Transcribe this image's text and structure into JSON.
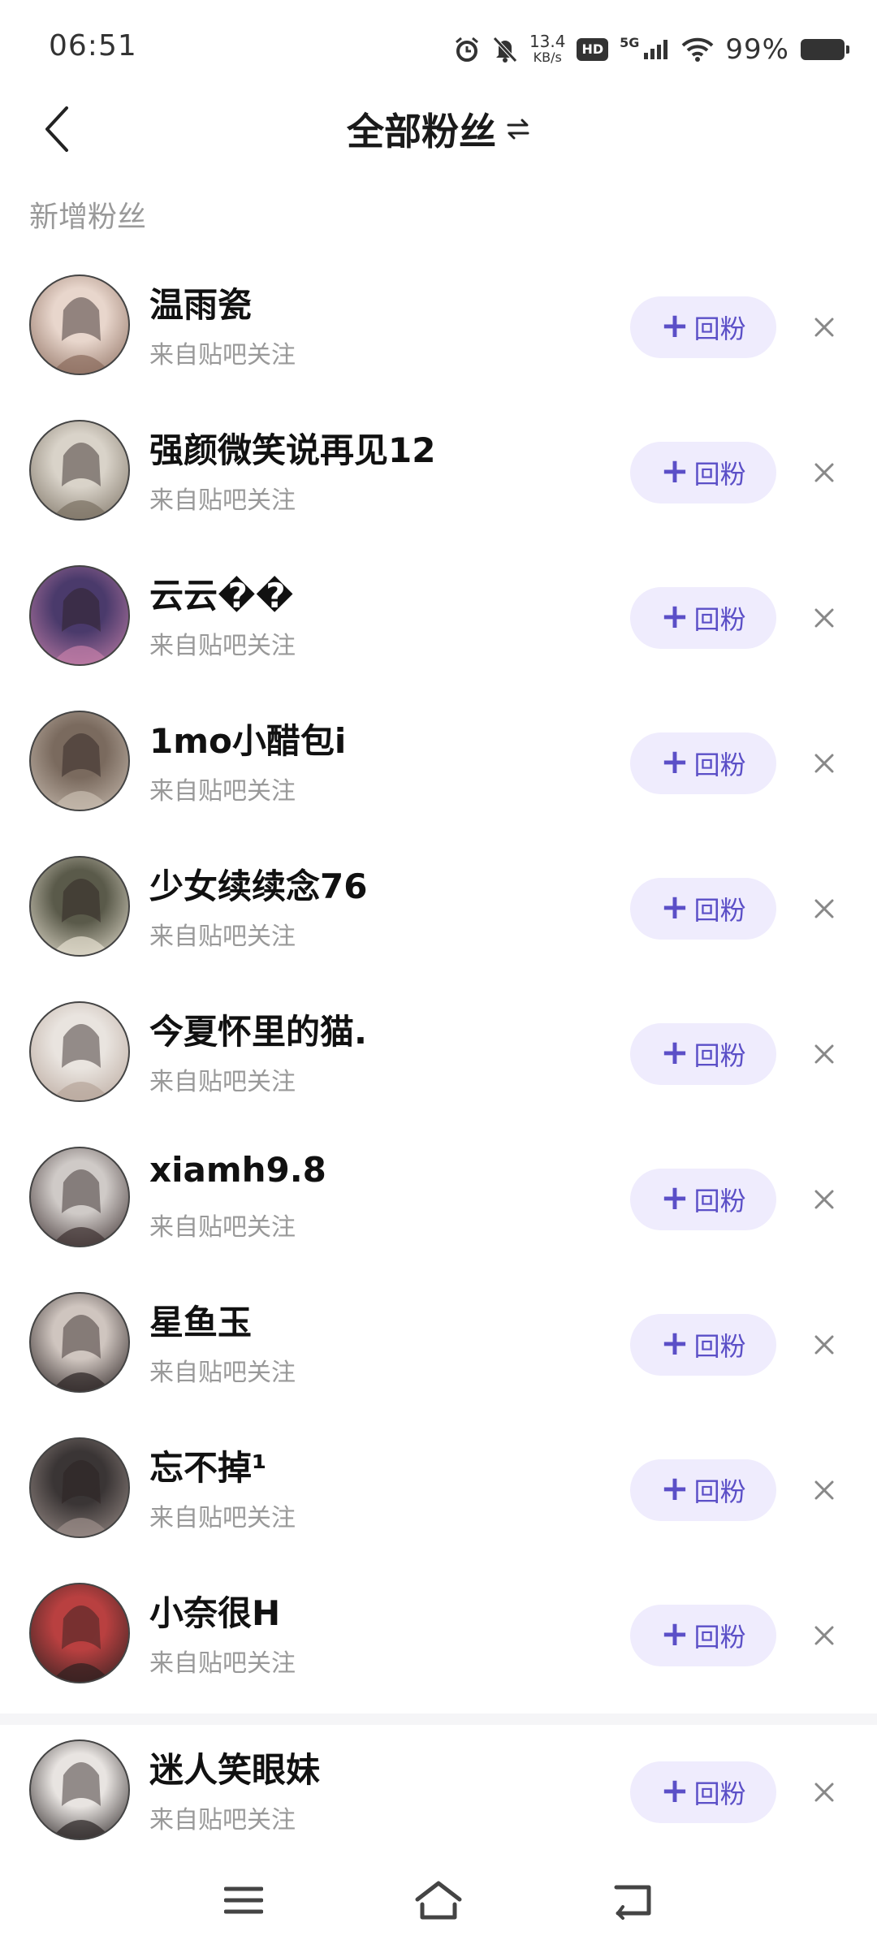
{
  "status_bar": {
    "time": "06:51",
    "net_speed_value": "13.4",
    "net_speed_unit": "KB/s",
    "hd_label": "HD",
    "signal_label": "5G",
    "battery_percent": "99%",
    "icons": [
      "alarm-icon",
      "mute-bell-icon",
      "hd-icon",
      "signal-5g-icon",
      "wifi-icon",
      "battery-icon"
    ]
  },
  "header": {
    "title": "全部粉丝",
    "back_icon": "chevron-left-icon",
    "switch_icon": "swap-arrows-icon"
  },
  "section": {
    "label": "新增粉丝"
  },
  "follow_button_label": "回粉",
  "follow_button_plus": "+",
  "colors": {
    "accent": "#5b4fc7",
    "button_bg": "#efecfd",
    "secondary_text": "#999999"
  },
  "fans": [
    {
      "name": "温雨瓷",
      "source": "来自贴吧关注"
    },
    {
      "name": "强颜微笑说再见12",
      "source": "来自贴吧关注"
    },
    {
      "name": "云云��",
      "source": "来自贴吧关注"
    },
    {
      "name": "1mo小醋包i",
      "source": "来自贴吧关注"
    },
    {
      "name": "少女续续念76",
      "source": "来自贴吧关注"
    },
    {
      "name": "今夏怀里的猫.",
      "source": "来自贴吧关注"
    },
    {
      "name": "xiamh9.8",
      "source": "来自贴吧关注"
    },
    {
      "name": "星鱼玉",
      "source": "来自贴吧关注"
    },
    {
      "name": "忘不掉¹",
      "source": "来自贴吧关注"
    },
    {
      "name": "小奈很H",
      "source": "来自贴吧关注"
    },
    {
      "name": "迷人笑眼妹",
      "source": "来自贴吧关注"
    }
  ],
  "bottom_nav": {
    "icons": [
      "menu-icon",
      "home-icon",
      "back-icon"
    ]
  }
}
